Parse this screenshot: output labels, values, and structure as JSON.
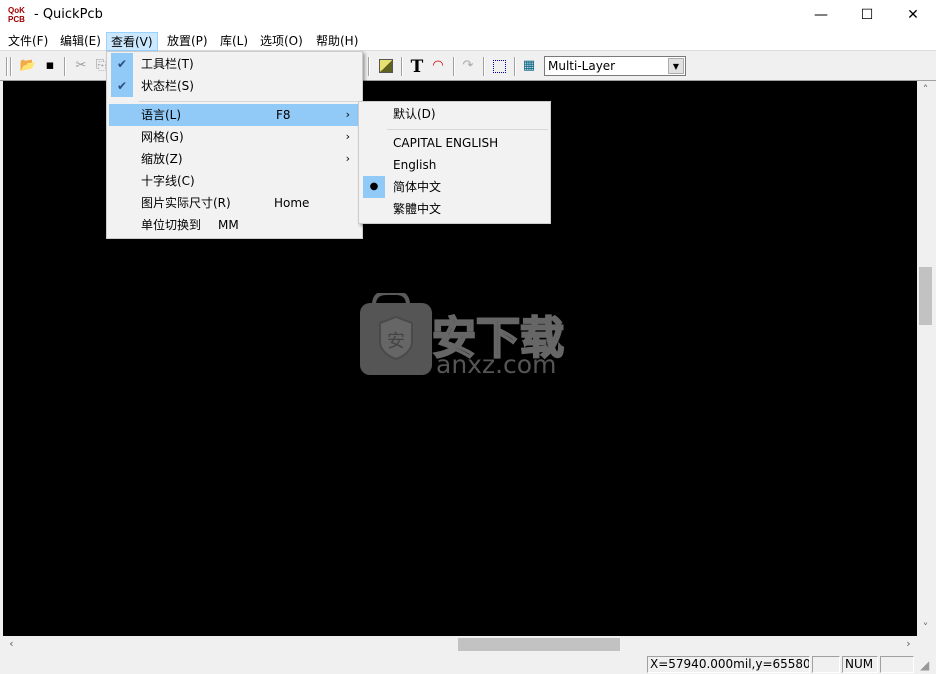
{
  "window": {
    "title": "- QuickPcb",
    "icon_text": "QoK PCB",
    "minimize": "—",
    "maximize": "☐",
    "close": "✕"
  },
  "menubar": [
    "文件(F)",
    "编辑(E)",
    "查看(V)",
    "放置(P)",
    "库(L)",
    "选项(O)",
    "帮助(H)"
  ],
  "toolbar": {
    "layer_select": "Multi-Layer"
  },
  "view_menu": {
    "items": [
      {
        "label": "工具栏(T)",
        "checked": true
      },
      {
        "label": "状态栏(S)",
        "checked": true
      },
      {
        "label": "语言(L)",
        "shortcut": "F8",
        "submenu": true
      },
      {
        "label": "网格(G)",
        "submenu": true
      },
      {
        "label": "缩放(Z)",
        "submenu": true
      },
      {
        "label": "十字线(C)"
      },
      {
        "label": "图片实际尺寸(R)",
        "shortcut": "Home"
      },
      {
        "label": "单位切换到",
        "shortcut": "MM"
      }
    ]
  },
  "language_menu": {
    "items": [
      {
        "label": "默认(D)"
      },
      {
        "label": "CAPITAL ENGLISH"
      },
      {
        "label": "English"
      },
      {
        "label": "简体中文",
        "selected": true
      },
      {
        "label": "繁體中文"
      }
    ]
  },
  "watermark": {
    "text": "安下载",
    "domain": "anxz.com"
  },
  "statusbar": {
    "coords": "X=57940.000mil,y=65580.0(",
    "num": "NUM"
  }
}
